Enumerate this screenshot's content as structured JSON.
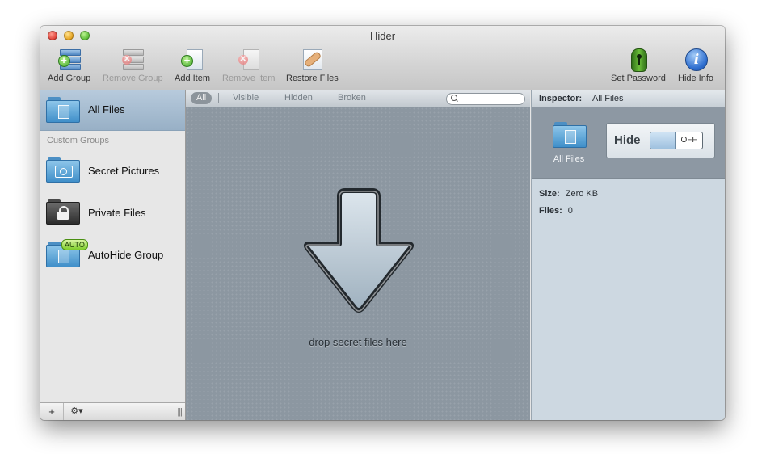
{
  "window": {
    "title": "Hider"
  },
  "toolbar": {
    "add_group": "Add Group",
    "remove_group": "Remove Group",
    "add_item": "Add Item",
    "remove_item": "Remove Item",
    "restore_files": "Restore Files",
    "set_password": "Set Password",
    "hide_info": "Hide Info"
  },
  "sidebar": {
    "all_files": "All Files",
    "section_label": "Custom Groups",
    "groups": [
      {
        "label": "Secret Pictures",
        "icon": "camera-folder-icon"
      },
      {
        "label": "Private Files",
        "icon": "lock-folder-icon"
      },
      {
        "label": "AutoHide Group",
        "icon": "auto-folder-icon",
        "badge": "AUTO"
      }
    ],
    "bottom": {
      "add": "+",
      "gear": "⚙▾",
      "grip": "|||"
    }
  },
  "filters": {
    "all": "All",
    "visible": "Visible",
    "hidden": "Hidden",
    "broken": "Broken",
    "search_placeholder": ""
  },
  "dropzone": {
    "label": "drop secret files here"
  },
  "inspector": {
    "label": "Inspector:",
    "target": "All Files",
    "folder_label": "All Files",
    "hide_label": "Hide",
    "toggle_state": "OFF",
    "size_label": "Size:",
    "size_value": "Zero KB",
    "files_label": "Files:",
    "files_value": "0"
  },
  "colors": {
    "selection": "#a9bfd3",
    "content": "#8c97a1",
    "inspector": "#cdd8e1"
  }
}
